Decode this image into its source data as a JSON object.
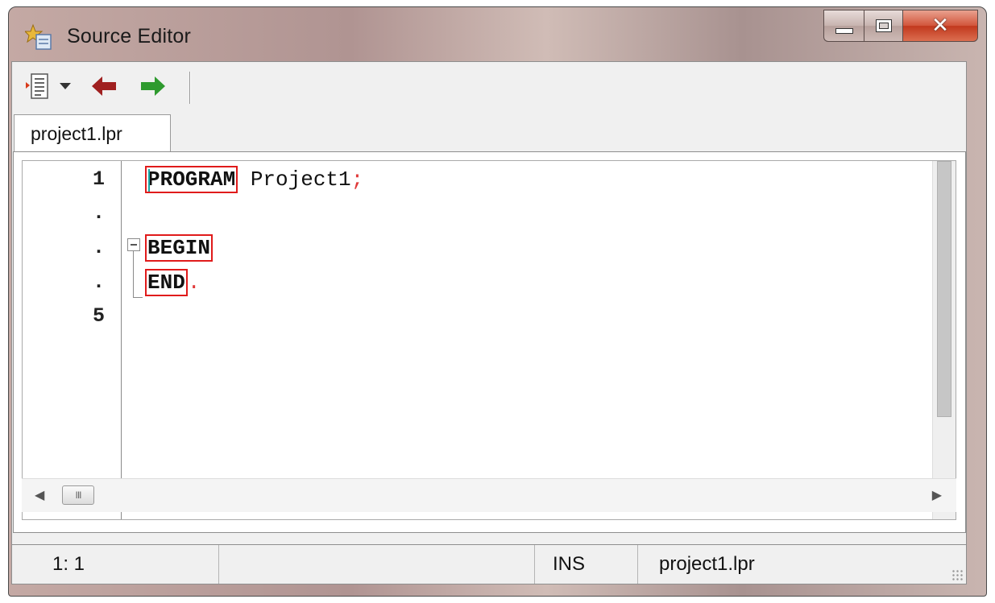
{
  "window": {
    "title": "Source Editor"
  },
  "toolbar": {
    "items": [
      "document-list-icon",
      "dropdown-arrow-icon",
      "back-arrow-icon",
      "forward-arrow-icon"
    ]
  },
  "tabs": [
    {
      "label": "project1.lpr",
      "active": true
    }
  ],
  "editor": {
    "gutter": [
      "1",
      ".",
      ".",
      ".",
      "5"
    ],
    "lines": [
      {
        "kw": "PROGRAM",
        "rest": " Project1",
        "punct": ";"
      },
      {
        "kw": "",
        "rest": "",
        "punct": ""
      },
      {
        "kw": "BEGIN",
        "rest": "",
        "punct": ""
      },
      {
        "kw": "END",
        "rest": "",
        "punct": "."
      },
      {
        "kw": "",
        "rest": "",
        "punct": ""
      }
    ],
    "hscroll_thumb": "III"
  },
  "statusbar": {
    "position": "1: 1",
    "mode": "INS",
    "filename": "project1.lpr"
  },
  "colors": {
    "keyword_box": "#e01b1b",
    "punctuation": "#e03a3a",
    "forward_arrow": "#2e9a2e",
    "back_arrow": "#a02020"
  }
}
